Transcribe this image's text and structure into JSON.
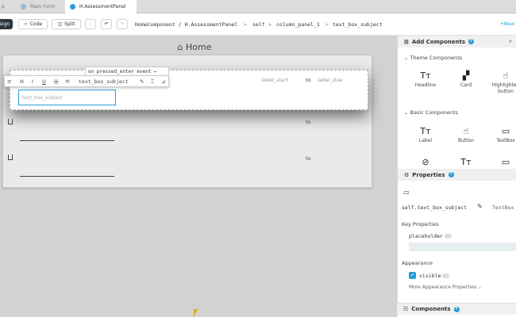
{
  "tabs": [
    {
      "label": "p",
      "active": false
    },
    {
      "label": "Main Form",
      "active": false
    },
    {
      "label": "H.AssessmentPanel",
      "active": true
    }
  ],
  "toolbar": {
    "design_label": "sign",
    "code_label": "Code",
    "split_label": "Split",
    "more_label": "⋮",
    "undo_label": "↶",
    "redo_label": "↷",
    "breadcrumb": [
      "HomeComponent / H.AssessmentPanel",
      ">",
      "self",
      ">",
      "column_panel_1",
      ">",
      "text_box_subject"
    ],
    "new_label": "New"
  },
  "canvas": {
    "home_title": "Home",
    "tag_label": "on pressed_enter event",
    "tag_arrow": "→",
    "component_name": "text_box_subject",
    "placeholder": "text_box_subject",
    "label_start": "label_start",
    "to_label": "to",
    "label_due": "label_due",
    "row2_to": "to",
    "row3_to": "to"
  },
  "float_toolbar": {
    "icons": [
      "≡",
      "H",
      "I",
      "U",
      "∞",
      "⟲",
      "✎",
      "⌶",
      "⊿"
    ]
  },
  "panel": {
    "add_components_title": "Add Components",
    "theme_section": "Theme Components",
    "theme_items": [
      {
        "icon": "Tт",
        "label": "Headline"
      },
      {
        "icon": "▞",
        "label": "Card"
      },
      {
        "icon": "☝",
        "label": "Highlighted button"
      }
    ],
    "basic_section": "Basic Components",
    "basic_items": [
      {
        "icon": "Tт",
        "label": "Label"
      },
      {
        "icon": "☝",
        "label": "Button"
      },
      {
        "icon": "▭",
        "label": "TextBox"
      },
      {
        "icon": "⊘",
        "label": ""
      },
      {
        "icon": "Tт",
        "label": ""
      },
      {
        "icon": "▭",
        "label": ""
      }
    ],
    "properties_title": "Properties",
    "object_name": "self.text_box_subject",
    "object_type": "TextBox",
    "key_properties": "Key Properties",
    "placeholder_prop": "placeholder",
    "appearance": "Appearance",
    "visible_prop": "visible",
    "more_appearance": "More Appearance Properties",
    "components_title": "Components"
  }
}
